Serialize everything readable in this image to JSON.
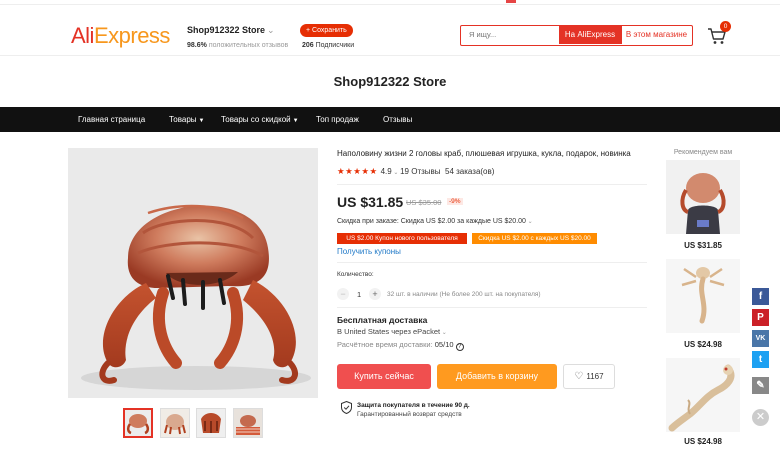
{
  "header": {
    "logo_ali": "Ali",
    "logo_express": "Express",
    "store_name": "Shop912322 Store",
    "feedback_percent": "98.6%",
    "feedback_text": "положительных отзывов",
    "save_label": "+ Сохранить",
    "subscribers_count": "206",
    "subscribers_label": "Подписчики",
    "search_placeholder": "Я ищу...",
    "search_on_aliexpress": "На AliExpress",
    "search_in_store": "В этом магазине",
    "cart_count": "0"
  },
  "store_title": "Shop912322 Store",
  "nav": {
    "home": "Главная страница",
    "products": "Товары",
    "discounted": "Товары со скидкой",
    "top_sales": "Топ продаж",
    "reviews": "Отзывы"
  },
  "product": {
    "title": "Наполовину жизни 2 головы краб, плюшевая игрушка, кукла, подарок, новинка",
    "stars": "★★★★★",
    "rating": "4.9",
    "reviews": "19 Отзывы",
    "orders": "54 заказа(ов)",
    "price": "US $31.85",
    "old_price": "US $35.00",
    "discount": "-9%",
    "order_discount": "Скидка при заказе: Скидка US $2.00 за каждые US $20.00",
    "coupon_new_user": "US $2.00 Купон нового пользователя",
    "coupon_store": "Скидка US $2.00 с каждых US $20.00",
    "get_coupons": "Получить купоны",
    "quantity_label": "Количество:",
    "quantity_value": "1",
    "stock_text": "32 шт. в наличии (Не более 200 шт. на покупателя)",
    "shipping_title": "Бесплатная доставка",
    "shipping_method": "В United States через ePacket",
    "delivery_label": "Расчётное время доставки:",
    "delivery_value": "05/10",
    "buy_now": "Купить сейчас",
    "add_to_cart": "Добавить в корзину",
    "wishlist_count": "1167",
    "protection_title": "Защита покупателя в течение 90 д.",
    "protection_sub": "Гарантированный возврат средств"
  },
  "recommendations": {
    "title": "Рекомендуем вам",
    "items": [
      {
        "price": "US $31.85"
      },
      {
        "price": "US $24.98"
      },
      {
        "price": "US $24.98"
      }
    ]
  },
  "colors": {
    "brand_red": "#e43225",
    "brand_orange": "#f7971d",
    "buy_red": "#f04f4f",
    "cart_orange": "#ff9a1f"
  },
  "social": [
    "facebook-icon",
    "pinterest-icon",
    "vk-icon",
    "twitter-icon",
    "edit-icon",
    "close-icon"
  ]
}
